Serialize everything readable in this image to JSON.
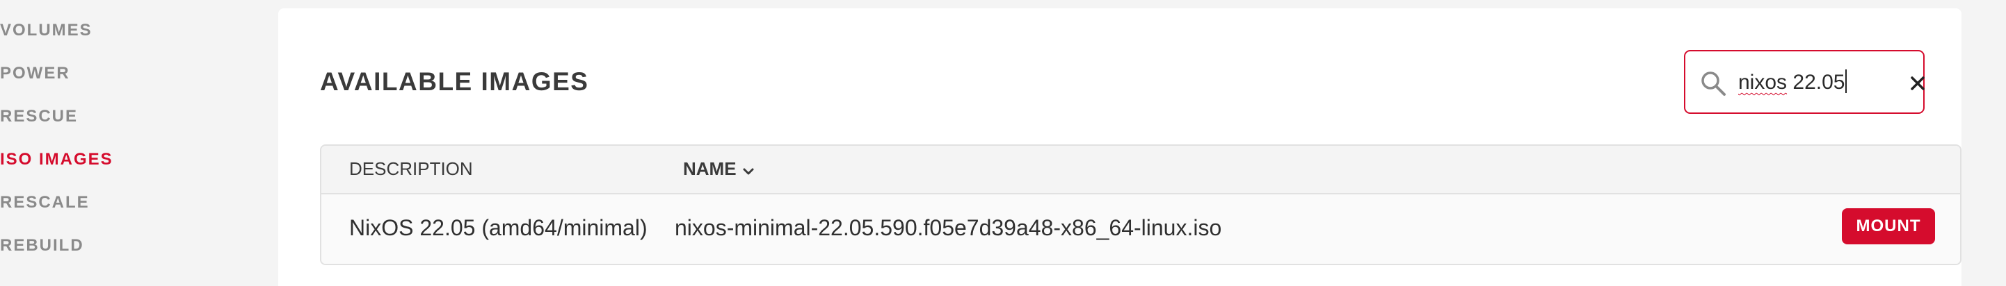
{
  "sidebar": {
    "items": [
      {
        "label": "VOLUMES",
        "active": false
      },
      {
        "label": "POWER",
        "active": false
      },
      {
        "label": "RESCUE",
        "active": false
      },
      {
        "label": "ISO IMAGES",
        "active": true
      },
      {
        "label": "RESCALE",
        "active": false
      },
      {
        "label": "REBUILD",
        "active": false
      }
    ]
  },
  "main": {
    "title": "AVAILABLE IMAGES",
    "search": {
      "value_word": "nixos",
      "value_rest": " 22.05",
      "search_icon": "search-icon",
      "clear_icon": "close-icon"
    },
    "table": {
      "headers": {
        "description": "DESCRIPTION",
        "name": "NAME",
        "sort_icon": "chevron-down-icon"
      },
      "rows": [
        {
          "description": "NixOS 22.05 (amd64/minimal)",
          "name": "nixos-minimal-22.05.590.f05e7d39a48-x86_64-linux.iso",
          "action": "MOUNT"
        }
      ]
    }
  },
  "colors": {
    "accent": "#d50c2d",
    "sidebar_text": "#8a8a8a",
    "background": "#f4f4f4"
  }
}
